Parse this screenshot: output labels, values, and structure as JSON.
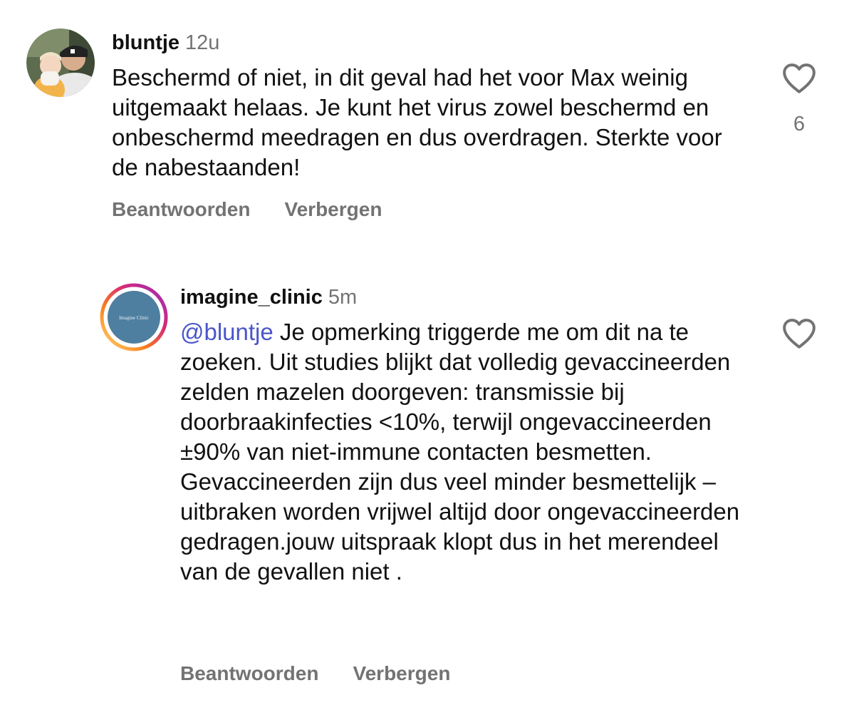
{
  "comments": [
    {
      "username": "bluntje",
      "time": "12u",
      "mention": "",
      "text": "Beschermd of niet, in dit geval had het voor Max weinig uitgemaakt helaas. Je kunt het virus zowel beschermd en onbeschermd meedragen en dus overdragen. Sterkte voor de nabestaanden!",
      "reply_label": "Beantwoorden",
      "hide_label": "Verbergen",
      "like_icon": "heart-outline-icon",
      "like_count": "6"
    },
    {
      "username": "imagine_clinic",
      "time": "5m",
      "mention": "@bluntje",
      "text": " Je opmerking triggerde me om dit na te zoeken. Uit studies blijkt dat volledig gevaccineerden zelden mazelen doorgeven: transmissie bij doorbraakinfecties <10%, terwijl ongevaccineerden ±90% van niet-immune contacten besmetten. Gevaccineerden zijn dus veel minder besmettelijk – uitbraken worden vrijwel altijd door ongevaccineerden gedragen.jouw uitspraak klopt dus in het merendeel van de gevallen niet .",
      "reply_label": "Beantwoorden",
      "hide_label": "Verbergen",
      "like_icon": "heart-outline-icon",
      "avatar_logo_text": "Imagine Clinic"
    }
  ],
  "colors": {
    "text": "#111111",
    "secondary": "#737373",
    "mention": "#4a56c9",
    "avatar_blue": "#4f7fa0",
    "story_ring": [
      "#feda75",
      "#fa7e1e",
      "#d62976",
      "#962fbf"
    ]
  }
}
